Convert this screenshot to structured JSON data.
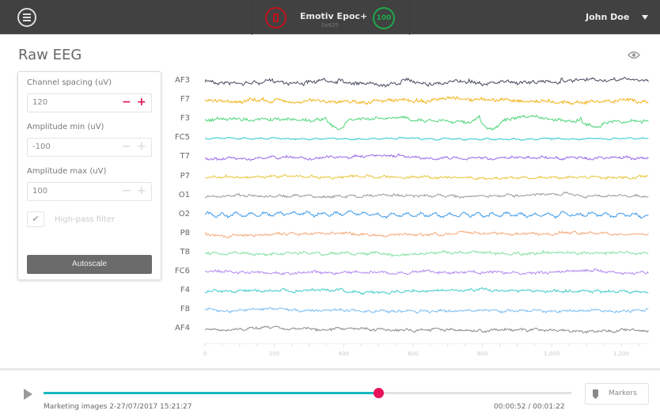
{
  "header": {
    "menu_icon": "hamburger-menu-icon",
    "device_name": "Emotiv Epoc+",
    "device_id": "0x625",
    "battery_icon": "battery-low-icon",
    "battery_color": "#c2121d",
    "signal_quality": "100",
    "signal_color": "#1eaa4a",
    "user_name": "John Doe"
  },
  "page": {
    "title": "Raw EEG",
    "visibility_icon": "eye-icon"
  },
  "settings": {
    "channel_spacing": {
      "label": "Channel spacing (uV)",
      "value": "120"
    },
    "amplitude_min": {
      "label": "Amplitude min (uV)",
      "value": "-100"
    },
    "amplitude_max": {
      "label": "Amplitude max (uV)",
      "value": "100"
    },
    "high_pass_filter": {
      "label": "High-pass filter",
      "checked": true
    },
    "autoscale_label": "Autoscale",
    "accent_color": "#e0114e"
  },
  "channels": [
    {
      "name": "AF3",
      "color": "#454a5e"
    },
    {
      "name": "F7",
      "color": "#f2b31a"
    },
    {
      "name": "F3",
      "color": "#4fd57a"
    },
    {
      "name": "FC5",
      "color": "#2cc8cc"
    },
    {
      "name": "T7",
      "color": "#9a68e8"
    },
    {
      "name": "P7",
      "color": "#e8c63a"
    },
    {
      "name": "O1",
      "color": "#999999"
    },
    {
      "name": "O2",
      "color": "#3d9ae8"
    },
    {
      "name": "P8",
      "color": "#f4a877"
    },
    {
      "name": "T8",
      "color": "#80e0a0"
    },
    {
      "name": "FC6",
      "color": "#b088f0"
    },
    {
      "name": "F4",
      "color": "#40ccc8"
    },
    {
      "name": "F8",
      "color": "#78bcf4"
    },
    {
      "name": "AF4",
      "color": "#888888"
    }
  ],
  "x_axis": {
    "min": 0,
    "max": 1280,
    "tick_labels": [
      "0",
      "200",
      "400",
      "600",
      "800",
      "1,000",
      "1,200"
    ]
  },
  "playback": {
    "session_label": "Marketing images 2-27/07/2017 15:21:27",
    "time_display": "00:00:52 / 00:01:22",
    "progress": 0.634,
    "progress_color": "#19b9c3",
    "knob_color": "#e8115a",
    "markers_label": "Markers"
  }
}
